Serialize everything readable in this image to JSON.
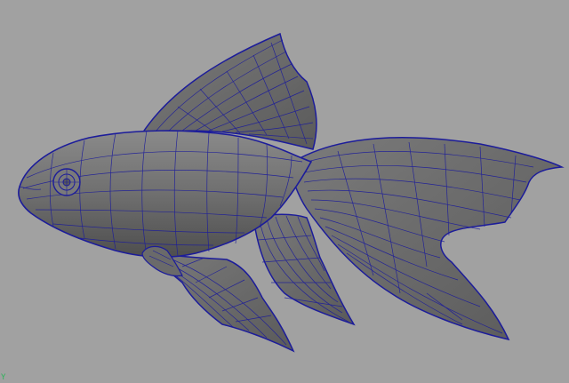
{
  "viewport": {
    "background": "#a1a1a1",
    "mesh_color": "#1c1c9a",
    "surface_color": "#6e6e6e",
    "model": "goldfish-wireframe-on-shaded",
    "axis_label": "Y",
    "axis_color": "#2fb35a"
  }
}
